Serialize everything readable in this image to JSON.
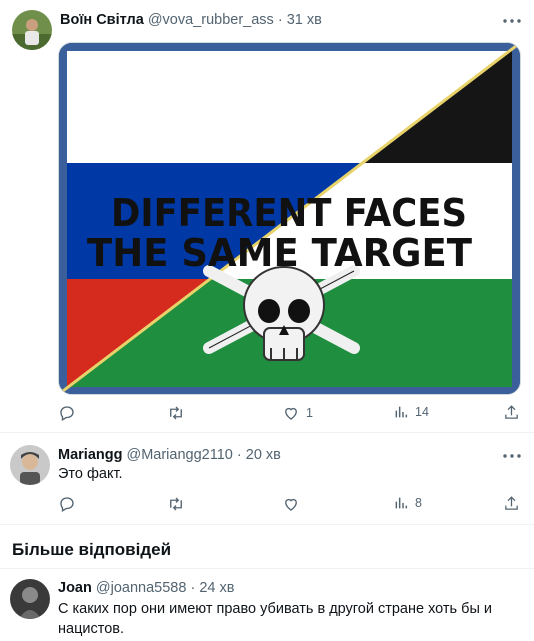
{
  "tweets": [
    {
      "name": "Воїн Світла",
      "handle": "@vova_rubber_ass",
      "time": "31 хв",
      "image_text": {
        "line1": "DIFFERENT FACES",
        "line2": "THE SAME TARGET"
      },
      "actions": {
        "reply": "",
        "retweet": "",
        "like": "1",
        "views": "14"
      }
    },
    {
      "name": "Mariangg",
      "handle": "@Mariangg2110",
      "time": "20 хв",
      "text": "Это факт.",
      "actions": {
        "reply": "",
        "retweet": "",
        "like": "",
        "views": "8"
      }
    }
  ],
  "more_replies_title": "Більше відповідей",
  "reply3": {
    "name": "Joan",
    "handle": "@joanna5588",
    "time": "24 хв",
    "text": "С каких пор они имеют право убивать в другой стране хоть бы и нацистов."
  },
  "icons": {
    "reply": "reply-icon",
    "retweet": "retweet-icon",
    "like": "like-icon",
    "views": "views-icon",
    "share": "share-icon",
    "more": "more-icon"
  },
  "colors": {
    "text": "#0f1419",
    "secondary": "#536471",
    "divider": "#eff3f4",
    "flag_red": "#d52b1e",
    "flag_blue": "#0039a6",
    "flag_green": "#1f8f3f"
  }
}
